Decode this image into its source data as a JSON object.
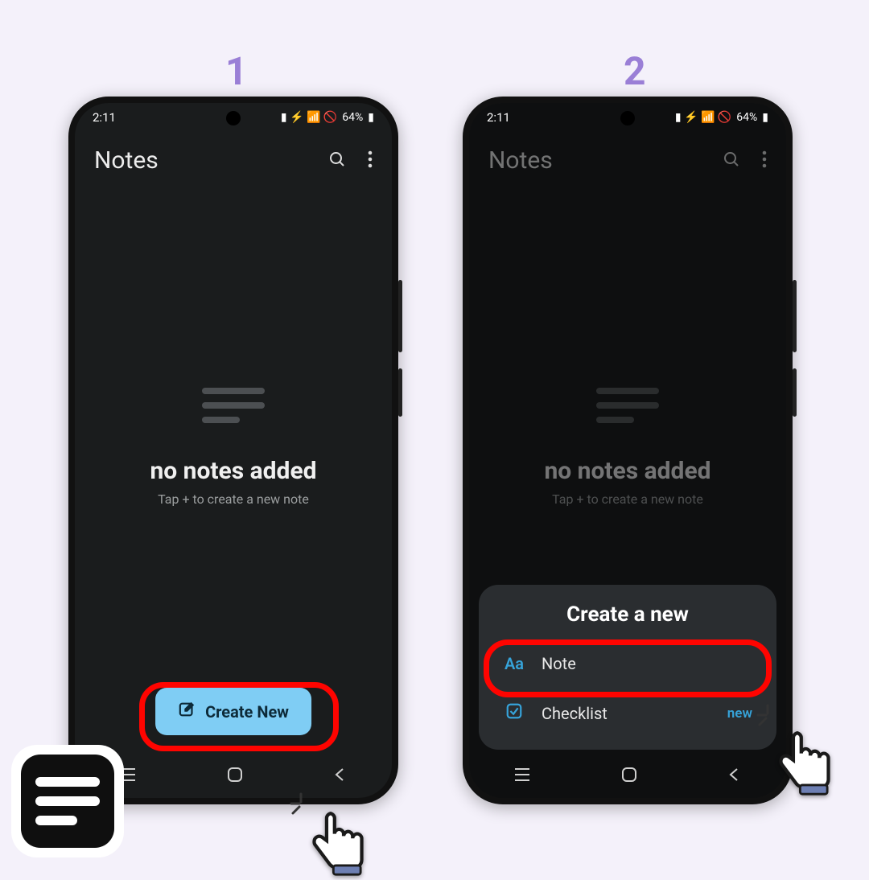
{
  "steps": {
    "one": "1",
    "two": "2"
  },
  "status": {
    "time": "2:11",
    "battery": "64%",
    "icons": "🖼  🔇 📶 🚫"
  },
  "header": {
    "title": "Notes"
  },
  "empty": {
    "title": "no notes added",
    "subtitle": "Tap + to create a new note"
  },
  "create_button": {
    "label": "Create New"
  },
  "sheet": {
    "title": "Create a new",
    "items": [
      {
        "icon": "Aa",
        "label": "Note"
      },
      {
        "icon": "check",
        "label": "Checklist",
        "badge": "new"
      }
    ]
  },
  "colors": {
    "accent": "#36a3d9",
    "highlight": "#ff0400",
    "button_bg": "#7fcdf4"
  }
}
